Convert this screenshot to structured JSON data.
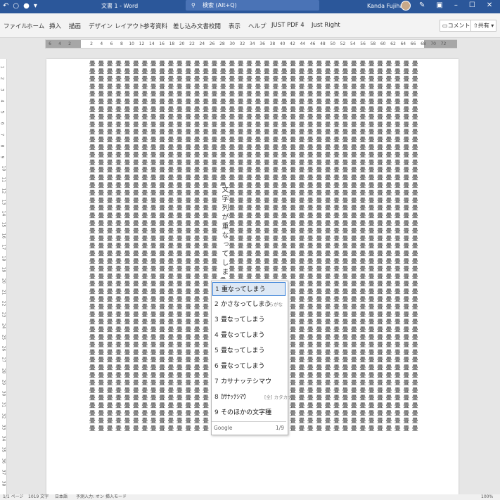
{
  "titlebar": {
    "title": "文書 1 - Word",
    "search_placeholder": "検索 (Alt+Q)",
    "user": "Kanda Fujiharu"
  },
  "ribbon": {
    "tabs": [
      "ファイル",
      "ホーム",
      "挿入",
      "描画",
      "デザイン",
      "レイアウト",
      "参考資料",
      "差し込み文書",
      "校閲",
      "表示",
      "ヘルプ",
      "JUST PDF 4",
      "Just Right"
    ],
    "comment_label": "コメント",
    "share_label": "共有"
  },
  "ruler": {
    "labels": [
      "6",
      "4",
      "2",
      "2",
      "4",
      "6",
      "8",
      "10",
      "12",
      "14",
      "16",
      "18",
      "20",
      "22",
      "24",
      "26",
      "28",
      "30",
      "32",
      "34",
      "36",
      "38",
      "40",
      "42",
      "44",
      "46",
      "48",
      "50",
      "52",
      "54",
      "56",
      "58",
      "60",
      "62",
      "64",
      "66",
      "68",
      "70",
      "72"
    ]
  },
  "vruler": {
    "labels": [
      "1",
      "2",
      "3",
      "4",
      "5",
      "6",
      "7",
      "8",
      "9",
      "10",
      "11",
      "12",
      "13",
      "14",
      "15",
      "16",
      "17",
      "18",
      "19",
      "20",
      "21",
      "22",
      "23",
      "24",
      "25",
      "26",
      "27",
      "28",
      "29",
      "30",
      "31",
      "32",
      "33",
      "34",
      "35",
      "36",
      "37",
      "38"
    ]
  },
  "document": {
    "overtype_text": "文字列が重なってしま",
    "fill_glyphs": "畳畳畳畳畳畳畳畳畳畳畳畳畳畳畳畳畳畳畳畳畳畳畳畳畳畳畳畳畳畳畳畳畳畳畳畳畳畳畳畳畳畳畳畳畳畳畳畳畳"
  },
  "ime": {
    "candidates": [
      {
        "num": "1",
        "text": "重なってしまう",
        "hint": ""
      },
      {
        "num": "2",
        "text": "かさなってしまう",
        "hint": "ひらがな"
      },
      {
        "num": "3",
        "text": "畳なってしまう",
        "hint": ""
      },
      {
        "num": "4",
        "text": "畳なってしまう",
        "hint": ""
      },
      {
        "num": "5",
        "text": "畳なってしまう",
        "hint": ""
      },
      {
        "num": "6",
        "text": "畳なってしまう",
        "hint": ""
      },
      {
        "num": "7",
        "text": "カサナッテシマウ",
        "hint": ""
      },
      {
        "num": "8",
        "text": "ｶｻﾅｯﾃｼﾏｳ",
        "hint": "[全] カタカナ"
      },
      {
        "num": "9",
        "text": "そのほかの文字種",
        "hint": ""
      }
    ],
    "footer_source": "Google",
    "footer_page": "1/9"
  },
  "status": {
    "page": "1/1 ページ",
    "words": "1019 文字",
    "lang": "日本語",
    "predict": "予測入力: オン",
    "mode": "挿入モード",
    "zoom": "100%"
  }
}
